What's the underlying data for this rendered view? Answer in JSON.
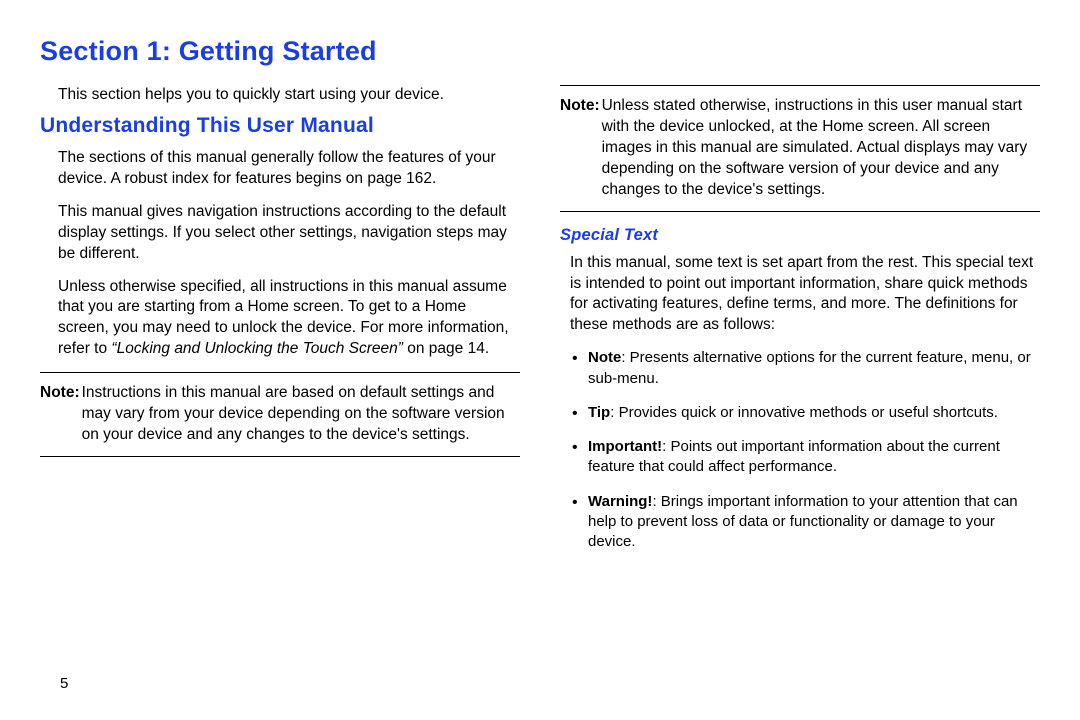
{
  "title": "Section 1: Getting Started",
  "intro": "This section helps you to quickly start using your device.",
  "h2": "Understanding This User Manual",
  "left": {
    "p1": "The sections of this manual generally follow the features of your device. A robust index for features begins on page 162.",
    "p2": "This manual gives navigation instructions according to the default display settings. If you select other settings, navigation steps may be different.",
    "p3a": "Unless otherwise specified, all instructions in this manual assume that you are starting from a Home screen. To get to a Home screen, you may need to unlock the device. For more information, refer to ",
    "p3xref": "“Locking and Unlocking the Touch Screen”",
    "p3b": " on page 14.",
    "note1_label": "Note:",
    "note1_text": "Instructions in this manual are based on default settings and may vary from your device depending on the software version on your device and any changes to the device's settings."
  },
  "right": {
    "note2_label": "Note:",
    "note2_text": "Unless stated otherwise, instructions in this user manual start with the device unlocked, at the Home screen. All screen images in this manual are simulated. Actual displays may vary depending on the software version of your device and any changes to the device's settings.",
    "h3": "Special Text",
    "p1": "In this manual, some text is set apart from the rest. This special text is intended to point out important information, share quick methods for activating features, define terms, and more. The definitions for these methods are as follows:",
    "bullets": [
      {
        "lead": "Note",
        "text": ": Presents alternative options for the current feature, menu, or sub-menu."
      },
      {
        "lead": "Tip",
        "text": ": Provides quick or innovative methods or useful shortcuts."
      },
      {
        "lead": "Important!",
        "text": ": Points out important information about the current feature that could affect performance."
      },
      {
        "lead": "Warning!",
        "text": ": Brings important information to your attention that can help to prevent loss of data or functionality or damage to your device."
      }
    ]
  },
  "page_number": "5"
}
